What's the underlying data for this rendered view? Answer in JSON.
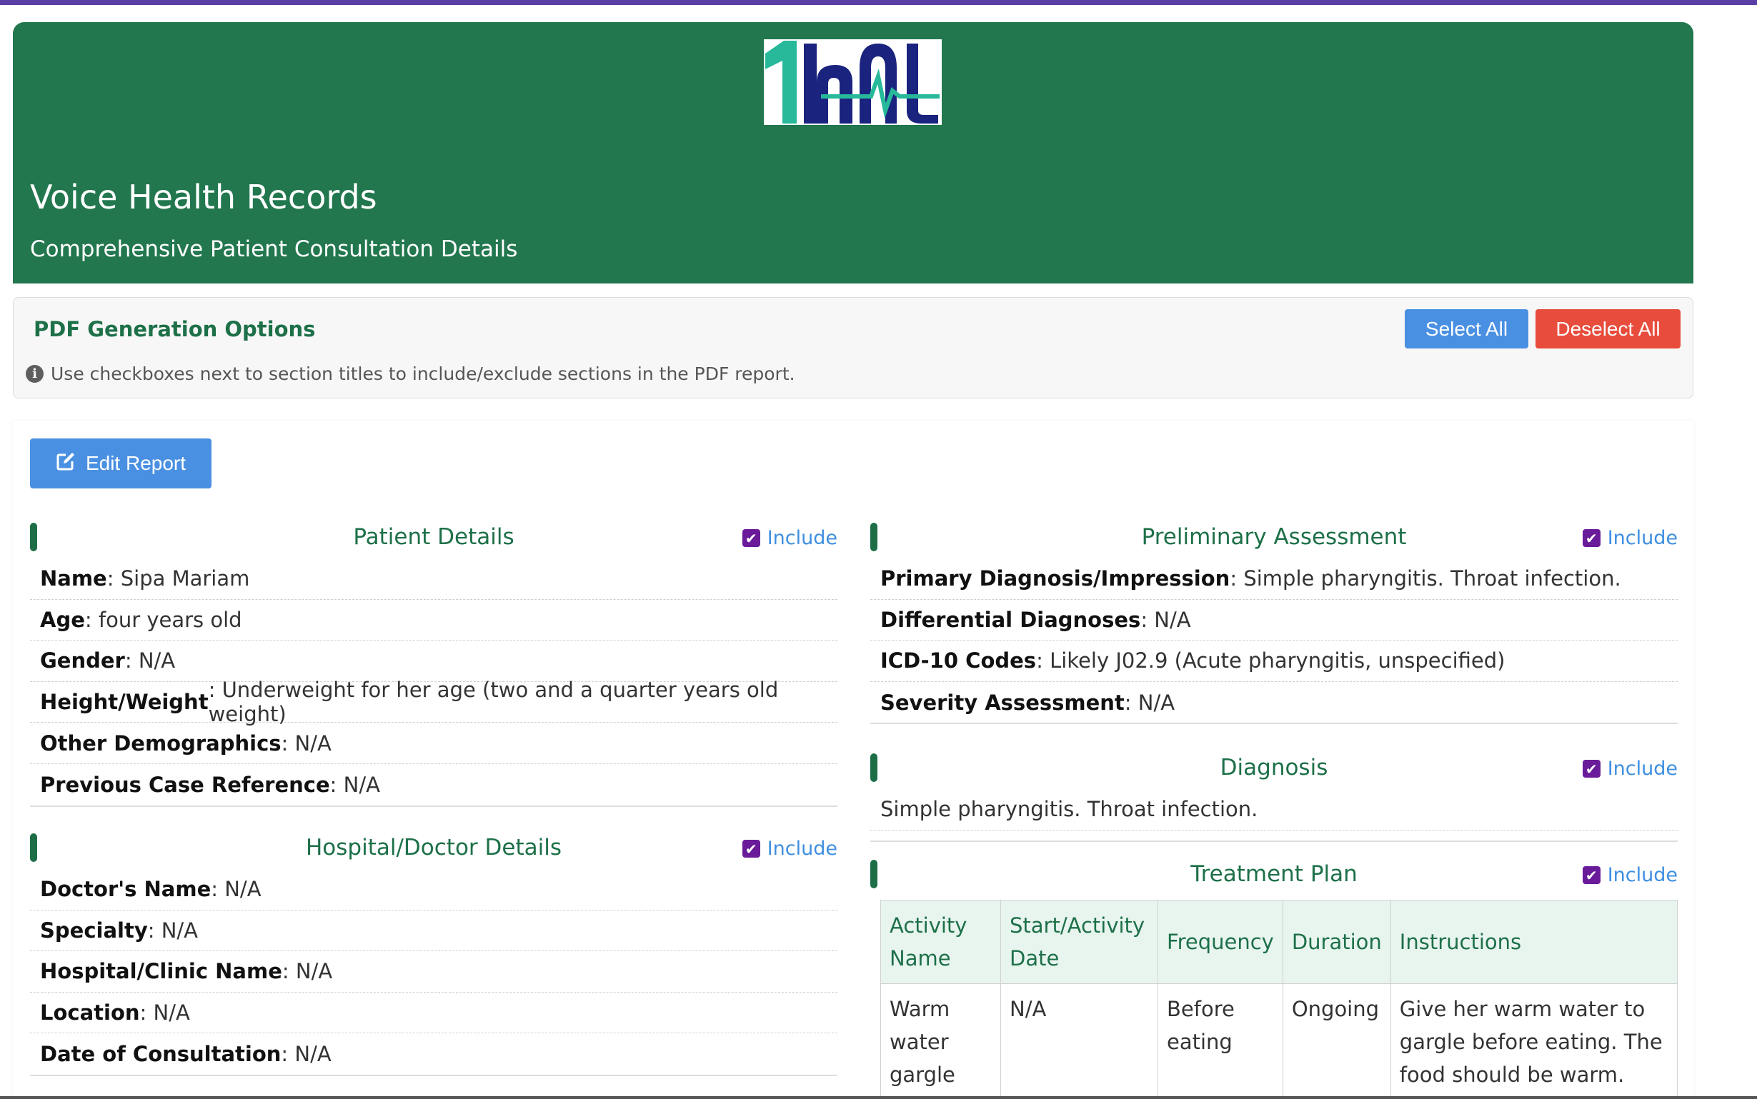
{
  "header": {
    "title": "Voice Health Records",
    "subtitle": "Comprehensive Patient Consultation Details"
  },
  "pdf_options": {
    "title": "PDF Generation Options",
    "hint": "Use checkboxes next to section titles to include/exclude sections in the PDF report.",
    "select_all": "Select All",
    "deselect_all": "Deselect All"
  },
  "edit_report": "Edit Report",
  "include_label": "Include",
  "patient_details": {
    "title": "Patient Details",
    "rows": [
      {
        "label": "Name",
        "value": ": Sipa Mariam"
      },
      {
        "label": "Age",
        "value": ": four years old"
      },
      {
        "label": "Gender",
        "value": ": N/A"
      },
      {
        "label": "Height/Weight",
        "value": ": Underweight for her age (two and a quarter years old weight)"
      },
      {
        "label": "Other Demographics",
        "value": ": N/A"
      },
      {
        "label": "Previous Case Reference",
        "value": ": N/A"
      }
    ]
  },
  "hospital_details": {
    "title": "Hospital/Doctor Details",
    "rows": [
      {
        "label": "Doctor's Name",
        "value": ": N/A"
      },
      {
        "label": "Specialty",
        "value": ": N/A"
      },
      {
        "label": "Hospital/Clinic Name",
        "value": ": N/A"
      },
      {
        "label": "Location",
        "value": ": N/A"
      },
      {
        "label": "Date of Consultation",
        "value": ": N/A"
      }
    ]
  },
  "preliminary_assessment": {
    "title": "Preliminary Assessment",
    "rows": [
      {
        "label": "Primary Diagnosis/Impression",
        "value": ": Simple pharyngitis. Throat infection."
      },
      {
        "label": "Differential Diagnoses",
        "value": ": N/A"
      },
      {
        "label": "ICD-10 Codes",
        "value": ": Likely J02.9 (Acute pharyngitis, unspecified)"
      },
      {
        "label": "Severity Assessment",
        "value": ": N/A"
      }
    ]
  },
  "diagnosis": {
    "title": "Diagnosis",
    "text": "Simple pharyngitis. Throat infection."
  },
  "treatment_plan": {
    "title": "Treatment Plan",
    "headers": [
      "Activity Name",
      "Start/Activity Date",
      "Frequency",
      "Duration",
      "Instructions"
    ],
    "rows": [
      [
        "Warm water gargle",
        "N/A",
        "Before eating",
        "Ongoing",
        "Give her warm water to gargle before eating. The food should be warm."
      ]
    ]
  },
  "colors": {
    "header_bg": "#22774e",
    "accent_green": "#1d7048",
    "button_blue": "#4a90e2",
    "button_red": "#e84c3d",
    "checkbox_purple": "#6a1b9a",
    "top_bar": "#5b3fa6"
  },
  "icons": {
    "info": "info-circle-icon",
    "edit": "edit-icon",
    "checkbox": "checkbox-checked-icon",
    "logo": "1hat-logo"
  }
}
